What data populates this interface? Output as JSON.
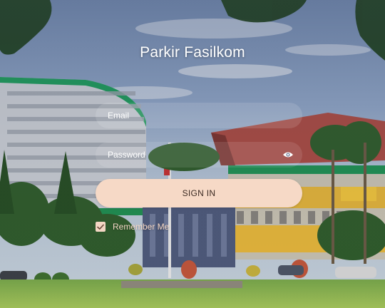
{
  "app": {
    "title": "Parkir Fasilkom"
  },
  "form": {
    "email_placeholder": "Email",
    "email_value": "",
    "password_placeholder": "Password",
    "password_value": "",
    "password_toggle_icon": "eye-icon",
    "signin_label": "SIGN IN",
    "remember_label": "Remember Me",
    "remember_checked": true
  },
  "colors": {
    "accent": "#f6d9c6",
    "button_text": "#3b2a22",
    "title_text": "#ffffff",
    "remember_text": "#f5d8c6"
  }
}
